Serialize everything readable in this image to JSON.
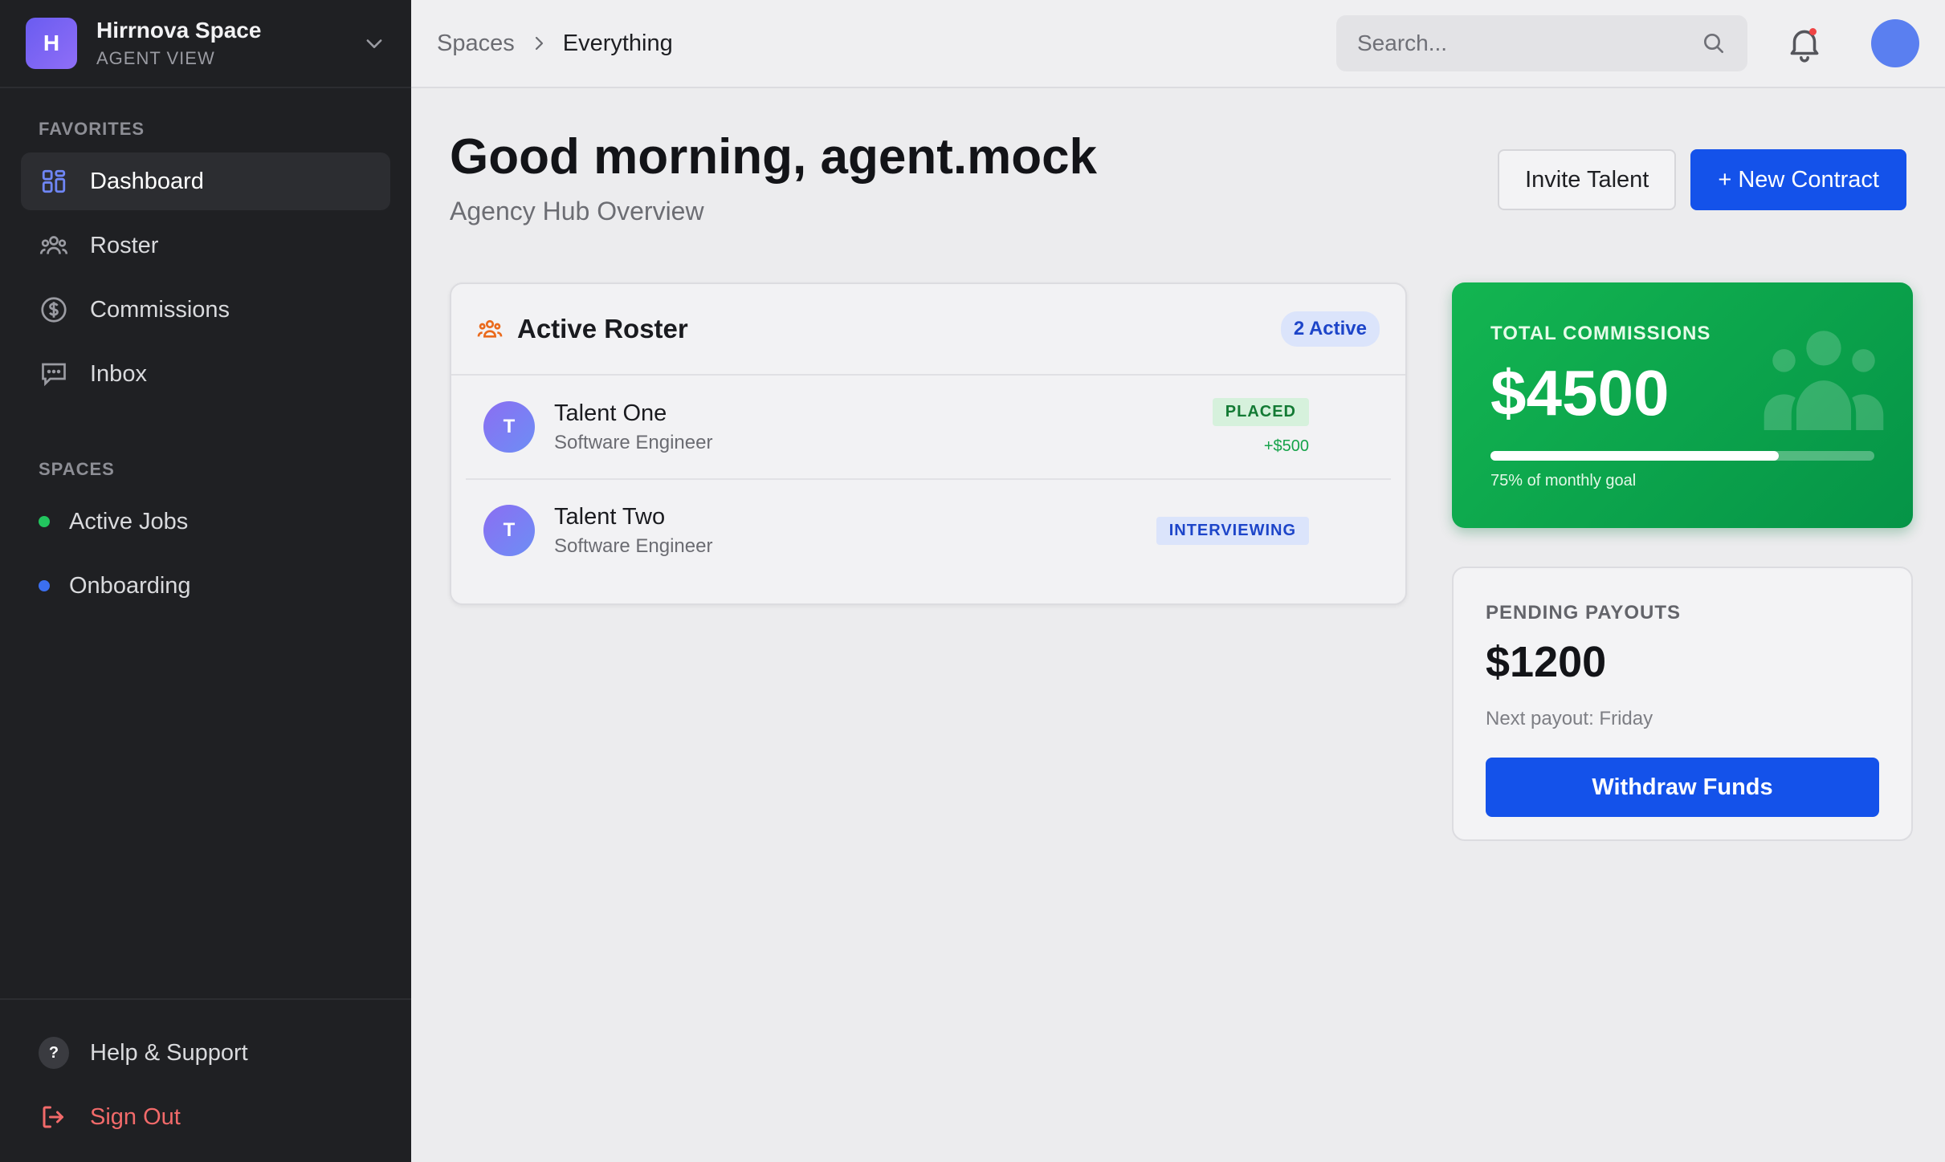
{
  "workspace": {
    "initial": "H",
    "name": "Hirrnova Space",
    "subtitle": "AGENT VIEW"
  },
  "sidebar": {
    "favorites_label": "FAVORITES",
    "items": [
      {
        "label": "Dashboard",
        "icon": "dashboard-icon",
        "active": true
      },
      {
        "label": "Roster",
        "icon": "users-icon"
      },
      {
        "label": "Commissions",
        "icon": "dollar-icon"
      },
      {
        "label": "Inbox",
        "icon": "chat-icon"
      }
    ],
    "spaces_label": "SPACES",
    "spaces": [
      {
        "label": "Active Jobs",
        "color": "#22c55e"
      },
      {
        "label": "Onboarding",
        "color": "#3b6ff0"
      }
    ],
    "help_label": "Help & Support",
    "help_glyph": "?",
    "signout_label": "Sign Out"
  },
  "topbar": {
    "breadcrumb": [
      "Spaces",
      "Everything"
    ],
    "search_placeholder": "Search..."
  },
  "header": {
    "greeting": "Good morning, agent.mock",
    "subtitle": "Agency Hub Overview",
    "invite_label": "Invite Talent",
    "new_contract_label": "+ New Contract"
  },
  "roster": {
    "title": "Active Roster",
    "active_badge": "2 Active",
    "rows": [
      {
        "initial": "T",
        "name": "Talent One",
        "role": "Software Engineer",
        "status": "PLACED",
        "amount": "+$500"
      },
      {
        "initial": "T",
        "name": "Talent Two",
        "role": "Software Engineer",
        "status": "INTERVIEWING"
      }
    ]
  },
  "commissions": {
    "label": "TOTAL COMMISSIONS",
    "value": "$4500",
    "progress": 0.75,
    "note": "75% of monthly goal"
  },
  "payouts": {
    "label": "PENDING PAYOUTS",
    "value": "$1200",
    "note": "Next payout: Friday",
    "button_label": "Withdraw Funds"
  },
  "colors": {
    "accent": "#1452ea",
    "success": "#13b551",
    "sidebar_bg": "#1f2023"
  }
}
